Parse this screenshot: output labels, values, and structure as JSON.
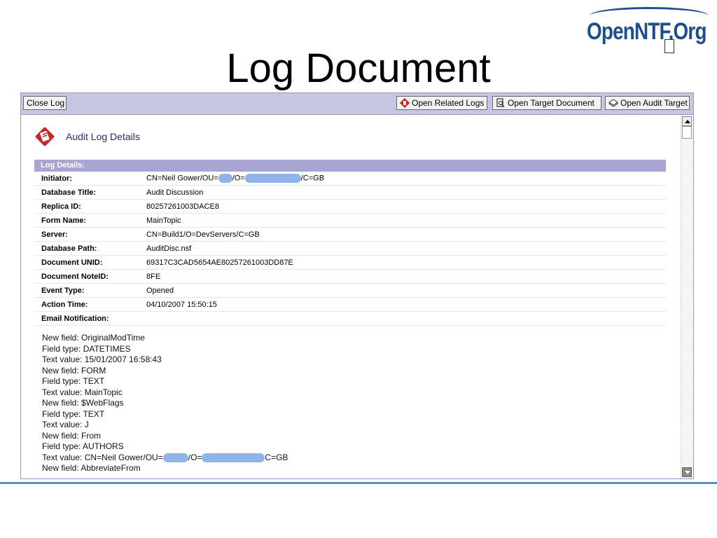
{
  "logo": {
    "text": "OpenNTF.Org"
  },
  "slide": {
    "title": "Log Document"
  },
  "toolbar": {
    "close_label": "Close Log",
    "related_label": "Open Related Logs",
    "target_label": "Open Target Document",
    "audit_label": "Open Audit Target"
  },
  "header": {
    "title": "Audit Log Details"
  },
  "details": {
    "section_label": "Log Details:",
    "initiator": {
      "key": "Initiator:",
      "v1": "CN=Neil Gower/OU=",
      "v2": "/O=",
      "v3": "/C=GB"
    },
    "rows": [
      {
        "key": "Database Title:",
        "value": "Audit Discussion"
      },
      {
        "key": "Replica ID:",
        "value": "80257261003DACE8"
      },
      {
        "key": "Form Name:",
        "value": "MainTopic"
      },
      {
        "key": "Server:",
        "value": "CN=Build1/O=DevServers/C=GB"
      },
      {
        "key": "Database Path:",
        "value": "AuditDisc.nsf"
      },
      {
        "key": "Document UNID:",
        "value": "69317C3CAD5654AE80257261003DD87E"
      },
      {
        "key": "Document NoteID:",
        "value": "8FE"
      },
      {
        "key": "Event Type:",
        "value": "Opened"
      },
      {
        "key": "Action Time:",
        "value": "04/10/2007 15:50:15"
      },
      {
        "key": "Email Notification:",
        "value": ""
      }
    ]
  },
  "log": {
    "lines": [
      "New field: OriginalModTime",
      "Field type: DATETIMES",
      "Text value: 15/01/2007 16:58:43",
      "New field: FORM",
      "Field type: TEXT",
      "Text value: MainTopic",
      "New field: $WebFlags",
      "Field type: TEXT",
      "Text value: J",
      "New field: From",
      "Field type: AUTHORS"
    ],
    "redacted_line": {
      "p1": "Text value: CN=Neil Gower/OU=",
      "p2": "/O=",
      "p3": "C=GB"
    },
    "last_line": "New field: AbbreviateFrom"
  },
  "colors": {
    "toolbar": "#c6c5e3",
    "section_bar": "#a8a6d0",
    "logo": "#1f4e8c",
    "rule": "#5b8fc7"
  }
}
